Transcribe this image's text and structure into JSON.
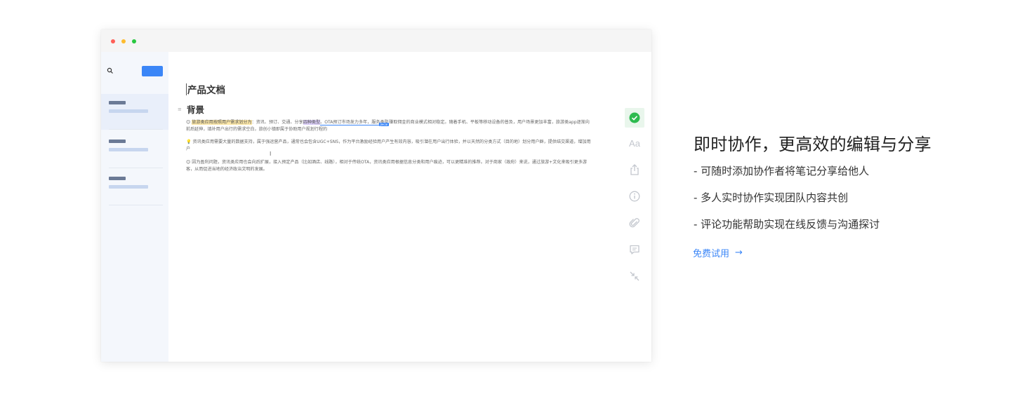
{
  "window": {
    "sidebar": {
      "item_count": 3
    },
    "editor": {
      "title": "产品文档",
      "heading": "背景",
      "heading_marker": "≡",
      "paragraphs": [
        {
          "emoji": "😊",
          "highlight_1": "旅游类应用按照用户需求划分为",
          "text_1": "：资讯、预订、交通、分享",
          "highlight_2": "四种类型",
          "text_2": "。OTA预订市场发力多年，服务类型",
          "tag": "Jiecai",
          "text_3": "赚取佣金的商业模式相对稳定。随着手机、平板等移动设备的普及，用户场景更加丰富，旅游类app逐渐向前后延伸，填补用户出行的需求空白，旅创小镇即属于协助用户规划行程的"
        },
        {
          "emoji": "💡",
          "text": "资讯类应用需要大量的数据支持，属于强运营产品，通常也会包含UGC+SNS，作为平台激励经验用户产生有效内容，吸引潜在用户出行体验，并以天然的分类方式（目的地）划分用户群，提供结交渠道，增加用户"
        },
        {
          "emoji": "😊",
          "text": "因为盈利问题，资讯类应用也会向后扩展，接入预定产品（比如酒店、线路），相对于传统OTA，资讯类应用根据信息分类和用户痕迹，可以更精准的推荐。对于商家（政府）来说，通过旅游+文化来吸引更多游客，从而促进当地的经济政治文明的发展。"
        }
      ],
      "tools": {
        "check": "check-icon",
        "font": "Aa",
        "share": "share-icon",
        "info": "info-icon",
        "attach": "paperclip-icon",
        "comment": "comment-icon",
        "collapse": "collapse-icon"
      }
    }
  },
  "feature": {
    "title": "即时协作，更高效的编辑与分享",
    "items": [
      "- 可随时添加协作者将笔记分享给他人",
      "- 多人实时协作实现团队内容共创",
      "- 评论功能帮助实现在线反馈与沟通探讨"
    ],
    "cta_label": "免费试用",
    "cta_arrow": "→"
  },
  "colors": {
    "accent": "#3b86f7",
    "check_green": "#2dbb4f",
    "sidebar_bg": "#f4f7fc"
  }
}
